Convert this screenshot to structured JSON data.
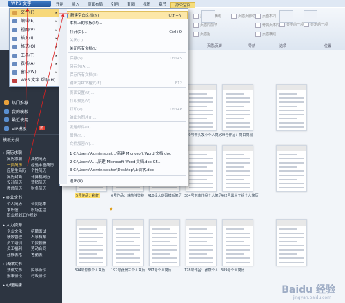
{
  "titlebar": {
    "app_button": "WPS 文字"
  },
  "ribbon": {
    "tabs": [
      "开始",
      "插入",
      "页面布局",
      "引用",
      "审阅",
      "视图",
      "章节",
      "办公空间"
    ],
    "active_tab": "办公空间",
    "controls": [
      "显示页眉横线",
      "页眉同前节",
      "页眉页脚切换",
      "页眉距",
      "显示前一项",
      "显示后一项",
      "页面不同",
      "奇偶页不同",
      "页眉横线"
    ],
    "groups": [
      "页眉/页脚",
      "导航",
      "选项",
      "位置"
    ]
  },
  "file_menu": {
    "items": [
      {
        "label": "文件(F)",
        "icon_color": "#d8a04a"
      },
      {
        "label": "编辑(E)",
        "icon_color": "#6a8cc0"
      },
      {
        "label": "视图(V)",
        "icon_color": "#6a8cc0"
      },
      {
        "label": "插入(I)",
        "icon_color": "#6a8cc0"
      },
      {
        "label": "格式(O)",
        "icon_color": "#6a8cc0"
      },
      {
        "label": "工具(T)",
        "icon_color": "#6a8cc0"
      },
      {
        "label": "表格(A)",
        "icon_color": "#6a8cc0"
      },
      {
        "label": "窗口(W)",
        "icon_color": "#6a8cc0"
      },
      {
        "label": "WPS 文字 帮助(H)",
        "icon_color": "#c04040"
      }
    ]
  },
  "submenu": {
    "items": [
      {
        "label": "新建空白文档(N)",
        "key": "Ctrl+N",
        "disabled": false
      },
      {
        "label": "本机上的模板(M)...",
        "key": "",
        "disabled": false
      },
      {
        "label": "打开(O)...",
        "key": "Ctrl+O",
        "disabled": false
      },
      {
        "label": "关闭(C)",
        "key": "",
        "disabled": true
      },
      {
        "label": "关闭所有文档(L)",
        "key": "",
        "disabled": false
      },
      {
        "label": "保存(S)",
        "key": "Ctrl+S",
        "disabled": true
      },
      {
        "label": "另存为(A)...",
        "key": "",
        "disabled": true
      },
      {
        "label": "保存所有文档(E)",
        "key": "",
        "disabled": true
      },
      {
        "label": "输出为PDF格式(F)...",
        "key": "F12",
        "disabled": true
      },
      {
        "label": "页面设置(U)...",
        "key": "",
        "disabled": true
      },
      {
        "label": "打印预览(V)",
        "key": "",
        "disabled": true
      },
      {
        "label": "打印(P)...",
        "key": "Ctrl+P",
        "disabled": true
      },
      {
        "label": "输出为图片(I)...",
        "key": "",
        "disabled": true
      },
      {
        "label": "发送邮件(D)...",
        "key": "",
        "disabled": true
      },
      {
        "label": "属性(I)...",
        "key": "",
        "disabled": true
      },
      {
        "label": "文件加密(Y)...",
        "key": "",
        "disabled": true
      },
      {
        "label": "1 C:\\Users\\Administrat...\\新建 Microsoft Word 文档.doc",
        "key": "",
        "disabled": false
      },
      {
        "label": "2 C:\\Users\\A...\\新建 Microsoft Word 文档.doc.C5...",
        "key": "",
        "disabled": false
      },
      {
        "label": "3 C:\\Users\\Administrator\\Desktop\\上调状.doc",
        "key": "",
        "disabled": false
      },
      {
        "label": "退出(X)",
        "key": "",
        "disabled": false
      }
    ]
  },
  "left_panel": {
    "nav": [
      {
        "label": "热门推荐",
        "color": "#e9a13b"
      },
      {
        "label": "我的模板",
        "color": "#5a8fd0"
      },
      {
        "label": "最近使用",
        "color": "#5a8fd0"
      },
      {
        "label": "VIP模板",
        "color": "#5a8fd0"
      }
    ],
    "vip_badge": "热",
    "section_title": "模板分类",
    "groups": [
      {
        "title": "简历求职",
        "items": [
          "简历求职",
          "其他简历",
          "一页简历",
          "经验丰富简历",
          "应届生简历",
          "个性简历",
          "简历封面",
          "计算机简历",
          "设计简历",
          "营销简历",
          "教师简历",
          "财务简历"
        ]
      },
      {
        "title": "办公文书",
        "items": [
          "个人简历",
          "合同范本",
          "求职信",
          "职场生活",
          "职业规划工作规划"
        ]
      },
      {
        "title": "人力资源",
        "items": [
          "企业文化",
          "招聘面试",
          "绩效管理",
          "人事档案",
          "员工培训",
          "工资薪酬",
          "员工福利",
          "劳动合同",
          "迁移表格",
          "考勤表"
        ]
      },
      {
        "title": "法律文书",
        "items": [
          "法律文书",
          "民事诉讼",
          "刑事诉讼",
          "行政诉讼"
        ]
      },
      {
        "title": "心理健康",
        "items": []
      }
    ]
  },
  "grid": {
    "rows": [
      [
        {
          "caption": "",
          "color": "#c9d4e3"
        },
        {
          "caption": "",
          "color": "#c9d4e3"
        },
        {
          "caption": "一页简历参考",
          "color": "#e8e8e8"
        },
        {
          "caption": "409号带头发小个人简历",
          "color": "#e8e8e8"
        },
        {
          "caption": "29号作品：简口简易",
          "color": "#e8e8e8"
        },
        {
          "caption": "",
          "color": "#e8e8e8"
        }
      ],
      [
        {
          "caption": "5号作品：彩虹",
          "color": "#f0c060"
        },
        {
          "caption": "6号作品：获简独鉴积",
          "color": "#e8e8e8"
        },
        {
          "caption": "410绿大定码模板简历",
          "color": "#e8e8e8"
        },
        {
          "caption": "384号刘菲作品个人简历",
          "color": "#e8e8e8"
        },
        {
          "caption": "402号黑大王组个人简历",
          "color": "#e8e8e8"
        },
        {
          "caption": "",
          "color": "#e8e8e8"
        }
      ],
      [
        {
          "caption": "394号影像个人简历",
          "color": "#e8e8e8"
        },
        {
          "caption": "192号张景三个人简历",
          "color": "#e8e8e8"
        },
        {
          "caption": "387号个人简历",
          "color": "#e8e8e8"
        },
        {
          "caption": "178号作品：张康个人...",
          "color": "#e8e8e8"
        },
        {
          "caption": "389号个人简历",
          "color": "#e8e8e8"
        },
        {
          "caption": "",
          "color": "#e8e8e8"
        }
      ]
    ]
  },
  "watermark": {
    "text": "Baidu 经验",
    "sub": "jingyan.baidu.com"
  },
  "selected_caption_badge": "★"
}
